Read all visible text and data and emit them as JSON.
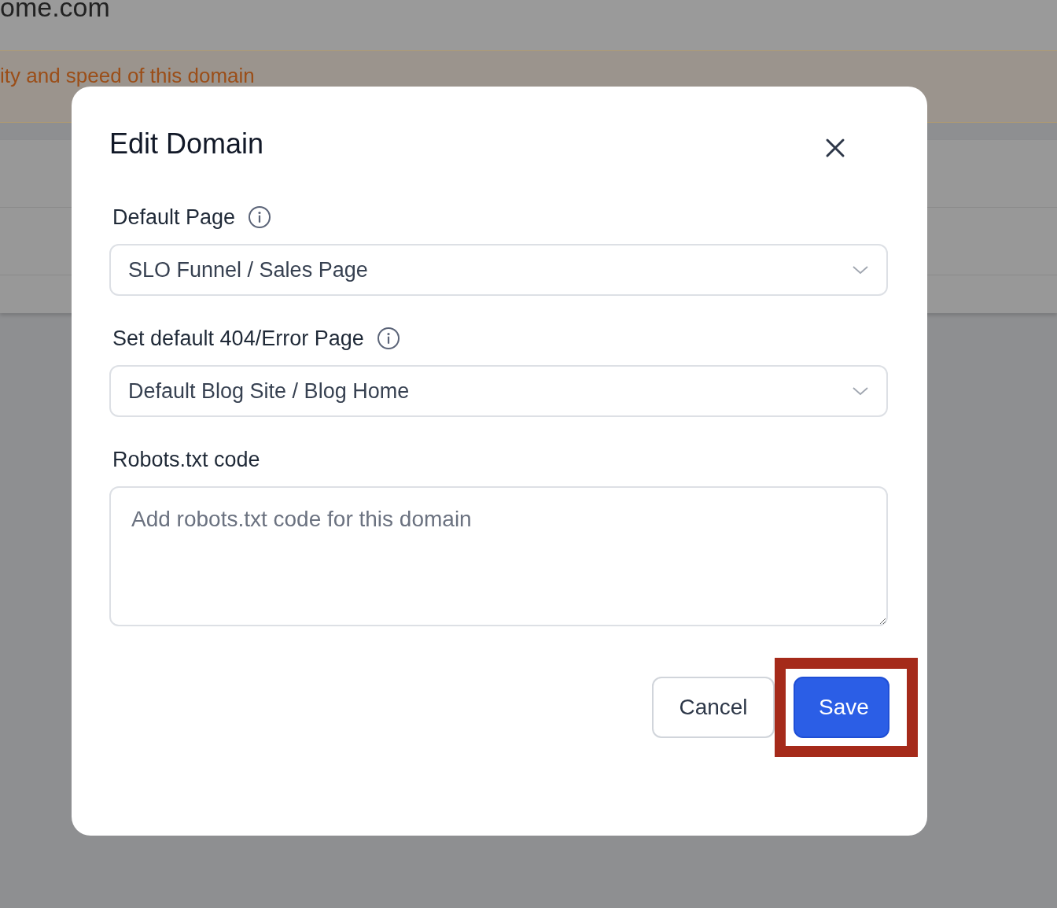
{
  "background": {
    "site_title": "ome.com",
    "notice": "ity and speed of this domain"
  },
  "dialog": {
    "title": "Edit Domain",
    "fields": [
      {
        "kind": "select",
        "label": "Default Page",
        "info": true,
        "value": "SLO Funnel / Sales Page"
      },
      {
        "kind": "select",
        "label": "Set default 404/Error Page",
        "info": true,
        "value": "Default Blog Site / Blog Home"
      },
      {
        "kind": "textarea",
        "label": "Robots.txt code",
        "info": false,
        "placeholder": "Add robots.txt code for this domain"
      }
    ],
    "buttons": [
      {
        "kind": "secondary",
        "label": "Cancel",
        "highlighted": false
      },
      {
        "kind": "primary",
        "label": "Save",
        "highlighted": true
      }
    ]
  }
}
